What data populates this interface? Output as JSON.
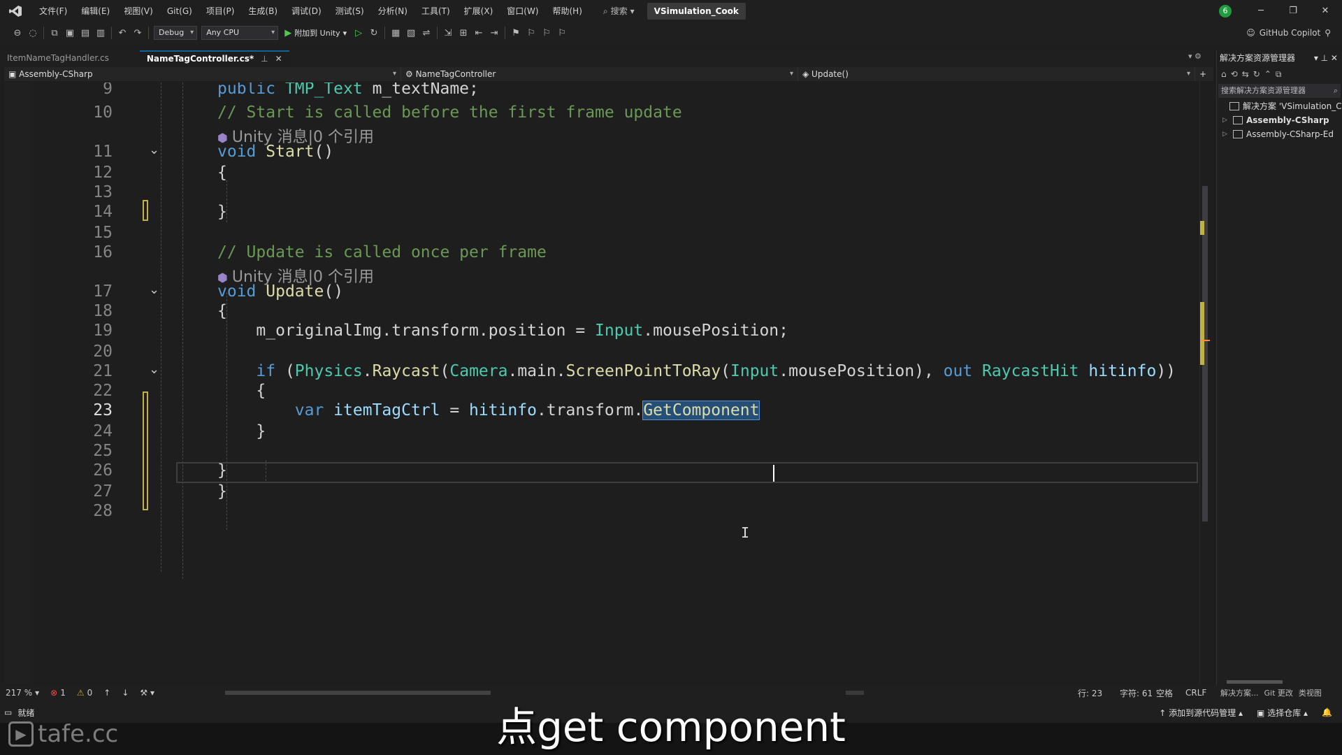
{
  "titlebar": {
    "menu": [
      "文件(F)",
      "编辑(E)",
      "视图(V)",
      "Git(G)",
      "项目(P)",
      "生成(B)",
      "调试(D)",
      "测试(S)",
      "分析(N)",
      "工具(T)",
      "扩展(X)",
      "窗口(W)",
      "帮助(H)"
    ],
    "search_label": "搜索",
    "solution_name": "VSimulation_Cook",
    "account_initial": "6"
  },
  "toolbar": {
    "config": "Debug",
    "platform": "Any CPU",
    "attach_label": "附加到 Unity",
    "copilot_label": "GitHub Copilot"
  },
  "tabs": [
    {
      "label": "ItemNameTagHandler.cs",
      "active": false
    },
    {
      "label": "NameTagController.cs*",
      "active": true
    }
  ],
  "navbar": {
    "project": "Assembly-CSharp",
    "class": "NameTagController",
    "member": "Update()"
  },
  "code": {
    "lines": {
      "l9": {
        "num": "9",
        "t": [
          [
            "kw",
            "public "
          ],
          [
            "ty",
            "TMP_Text "
          ],
          [
            "pl",
            "m_textName;"
          ]
        ]
      },
      "h1": {
        "hint": "Unity 消息|0 个引用"
      },
      "l10": {
        "num": "10",
        "t": [
          [
            "cm",
            "// Start is called before the first frame update"
          ]
        ]
      },
      "l11": {
        "num": "11",
        "t": [
          [
            "kw",
            "void "
          ],
          [
            "fn",
            "Start"
          ],
          [
            "pl",
            "()"
          ]
        ]
      },
      "l12": {
        "num": "12",
        "t": [
          [
            "pl",
            "{"
          ]
        ]
      },
      "l13": {
        "num": "13",
        "t": [
          [
            "pl",
            ""
          ]
        ]
      },
      "l14": {
        "num": "14",
        "t": [
          [
            "pl",
            "}"
          ]
        ]
      },
      "l15": {
        "num": "15",
        "t": [
          [
            "pl",
            ""
          ]
        ]
      },
      "l16": {
        "num": "16",
        "t": [
          [
            "cm",
            "// Update is called once per frame"
          ]
        ]
      },
      "h2": {
        "hint": "Unity 消息|0 个引用"
      },
      "l17": {
        "num": "17",
        "t": [
          [
            "kw",
            "void "
          ],
          [
            "fn",
            "Update"
          ],
          [
            "pl",
            "()"
          ]
        ]
      },
      "l18": {
        "num": "18",
        "t": [
          [
            "pl",
            "{"
          ]
        ]
      },
      "l19": {
        "num": "19",
        "t": [
          [
            "pl",
            "    m_originalImg.transform.position = "
          ],
          [
            "ty",
            "Input"
          ],
          [
            "pl",
            ".mousePosition;"
          ]
        ]
      },
      "l20": {
        "num": "20",
        "t": [
          [
            "pl",
            ""
          ]
        ]
      },
      "l21": {
        "num": "21",
        "t": [
          [
            "kw",
            "    if "
          ],
          [
            "pl",
            "("
          ],
          [
            "ty",
            "Physics"
          ],
          [
            "pl",
            "."
          ],
          [
            "fn",
            "Raycast"
          ],
          [
            "pl",
            "("
          ],
          [
            "ty",
            "Camera"
          ],
          [
            "pl",
            ".main."
          ],
          [
            "fn",
            "ScreenPointToRay"
          ],
          [
            "pl",
            "("
          ],
          [
            "ty",
            "Input"
          ],
          [
            "pl",
            ".mousePosition), "
          ],
          [
            "kw",
            "out "
          ],
          [
            "ty",
            "RaycastHit "
          ],
          [
            "id",
            "hitinfo"
          ],
          [
            "pl",
            "))"
          ]
        ]
      },
      "l22": {
        "num": "22",
        "t": [
          [
            "pl",
            "    {"
          ]
        ]
      },
      "l23": {
        "num": "23",
        "t": [
          [
            "kw",
            "        var "
          ],
          [
            "id",
            "itemTagCtrl"
          ],
          [
            "pl",
            " = "
          ],
          [
            "id",
            "hitinfo"
          ],
          [
            "pl",
            ".transform."
          ],
          [
            "sel",
            "GetComponent"
          ]
        ]
      },
      "l24": {
        "num": "24",
        "t": [
          [
            "pl",
            "    }"
          ]
        ]
      },
      "l25": {
        "num": "25",
        "t": [
          [
            "pl",
            ""
          ]
        ]
      },
      "l26": {
        "num": "26",
        "t": [
          [
            "pl",
            "}"
          ]
        ]
      },
      "l27": {
        "num": "27",
        "t": [
          [
            "pl",
            "}"
          ]
        ]
      },
      "l28": {
        "num": "28",
        "t": [
          [
            "pl",
            ""
          ]
        ]
      }
    }
  },
  "solution_explorer": {
    "title": "解决方案资源管理器",
    "search_placeholder": "搜索解决方案资源管理器",
    "items": [
      "解决方案 'VSimulation_C",
      "Assembly-CSharp",
      "Assembly-CSharp-Ed"
    ]
  },
  "editor_footer": {
    "zoom": "217 %",
    "errors": "1",
    "warnings": "0",
    "line": "行: 23",
    "char": "字符: 61",
    "whitespace": "空格",
    "eol": "CRLF"
  },
  "panel_tabs": [
    "解决方案...",
    "Git 更改",
    "类视图"
  ],
  "statusbar": {
    "ready": "就绪",
    "add_source": "添加到源代码管理",
    "select_repo": "选择仓库"
  },
  "overlay": {
    "subtitle": "点get component",
    "watermark": "tafe.cc"
  },
  "colors": {
    "keyword": "#569cd6",
    "type": "#4ec9b0",
    "method": "#dcdcaa",
    "comment": "#6a9955",
    "identifier": "#9cdcfe",
    "change_marker": "#c2b148"
  }
}
